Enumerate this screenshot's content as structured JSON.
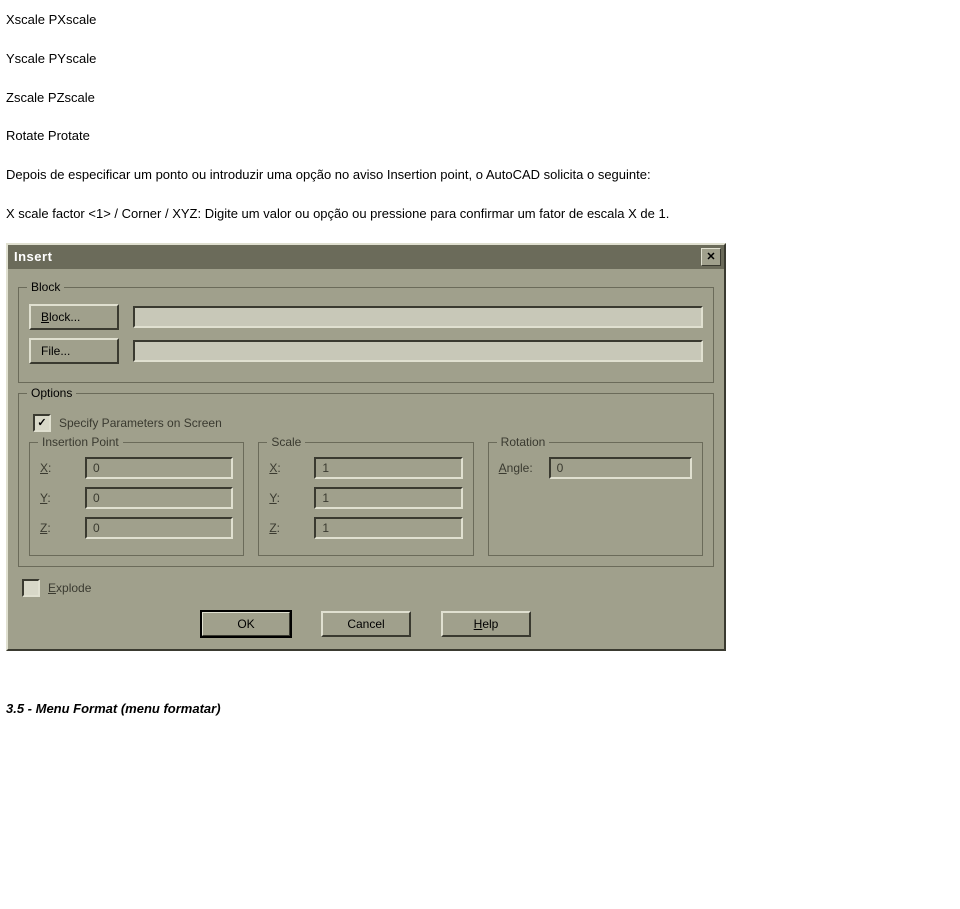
{
  "doc": {
    "line1": "Xscale PXscale",
    "line2": "Yscale PYscale",
    "line3": "Zscale PZscale",
    "line4": "Rotate Protate",
    "para1": "Depois de especificar um ponto ou introduzir uma opção no aviso Insertion point, o AutoCAD solicita o seguinte:",
    "para2": "X scale factor <1> / Corner / XYZ: Digite um valor ou opção ou pressione para confirmar um fator de escala X de 1.",
    "footer": "3.5 - Menu Format (menu formatar)"
  },
  "dialog": {
    "title": "Insert",
    "close": "✕",
    "groups": {
      "block": {
        "legend": "Block",
        "block_btn": "Block...",
        "file_btn": "File...",
        "block_value": "",
        "file_value": ""
      },
      "options": {
        "legend": "Options",
        "specify_checked": "✓",
        "specify_label": "Specify Parameters on Screen",
        "insertion": {
          "legend": "Insertion Point",
          "x": {
            "label": "X:",
            "value": "0"
          },
          "y": {
            "label": "Y:",
            "value": "0"
          },
          "z": {
            "label": "Z:",
            "value": "0"
          }
        },
        "scale": {
          "legend": "Scale",
          "x": {
            "label": "X:",
            "value": "1"
          },
          "y": {
            "label": "Y:",
            "value": "1"
          },
          "z": {
            "label": "Z:",
            "value": "1"
          }
        },
        "rotation": {
          "legend": "Rotation",
          "angle": {
            "label": "Angle:",
            "value": "0"
          }
        }
      },
      "explode": {
        "check": "",
        "label": "Explode"
      }
    },
    "buttons": {
      "ok": "OK",
      "cancel": "Cancel",
      "help": "Help"
    }
  }
}
